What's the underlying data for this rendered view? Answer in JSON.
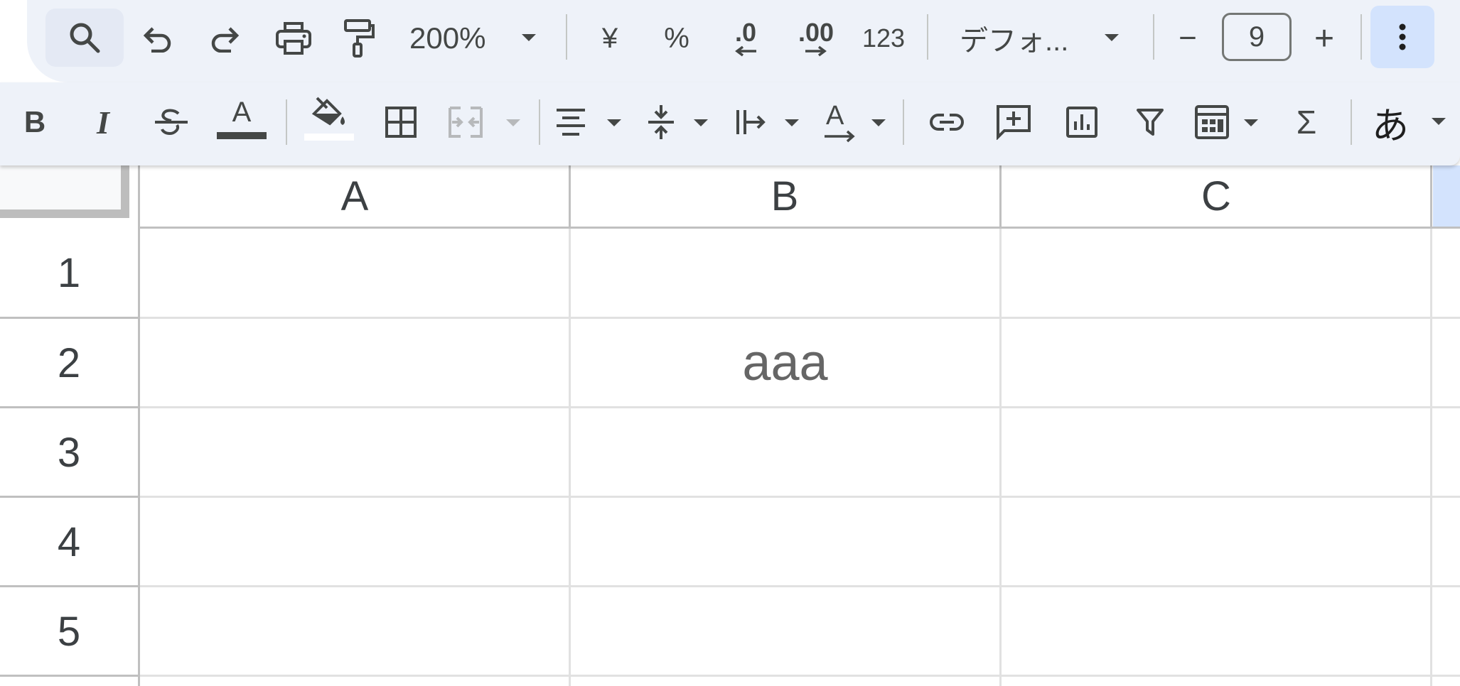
{
  "toolbar_top": {
    "zoom": "200%",
    "currency_symbol": "¥",
    "percent_symbol": "%",
    "decrease_decimal": ".0",
    "increase_decimal": ".00",
    "number_format": "123",
    "font_name": "デフォ...",
    "font_size_minus": "−",
    "font_size": "9",
    "font_size_plus": "+"
  },
  "toolbar_bottom": {
    "bold": "B",
    "italic": "I",
    "text_color_letter": "A",
    "text_rotation_letter": "A",
    "sum": "Σ",
    "input_tools": "あ"
  },
  "sheet": {
    "columns": [
      "A",
      "B",
      "C"
    ],
    "rows": [
      "1",
      "2",
      "3",
      "4",
      "5"
    ],
    "cells": {
      "B2": "aaa"
    }
  },
  "colors": {
    "toolbar_bg": "#eef2f9",
    "icon": "#444746",
    "grid_line": "#e1e1e1",
    "header_line": "#c0c0c0",
    "selected_more": "#d3e3fd"
  }
}
